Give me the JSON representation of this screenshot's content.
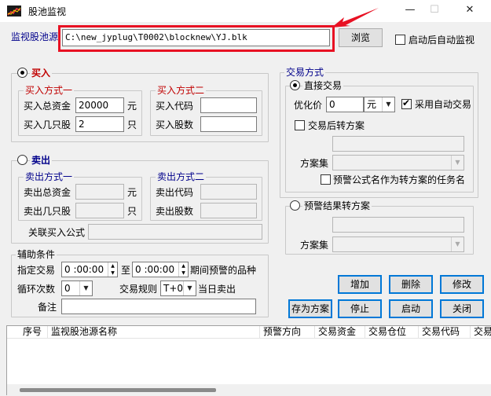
{
  "window": {
    "title": "股池监视",
    "min": "—",
    "max": "☐",
    "close": "✕"
  },
  "source": {
    "label": "监视股池源",
    "path": "C:\\new_jyplug\\T0002\\blocknew\\YJ.blk",
    "browse": "浏览",
    "autostart": "启动后自动监视",
    "autostart_checked": false
  },
  "buy": {
    "radio": "买入",
    "selected": true,
    "mode1": {
      "title": "买入方式一",
      "total_label": "买入总资金",
      "total_value": "20000",
      "total_unit": "元",
      "count_label": "买入几只股",
      "count_value": "2",
      "count_unit": "只"
    },
    "mode2": {
      "title": "买入方式二",
      "code_label": "买入代码",
      "qty_label": "买入股数"
    }
  },
  "sell": {
    "radio": "卖出",
    "selected": false,
    "mode1": {
      "title": "卖出方式一",
      "total_label": "卖出总资金",
      "total_unit": "元",
      "count_label": "卖出几只股",
      "count_unit": "只"
    },
    "mode2": {
      "title": "卖出方式二",
      "code_label": "卖出代码",
      "qty_label": "卖出股数"
    },
    "formula_label": "关联买入公式"
  },
  "trade": {
    "title": "交易方式",
    "direct": "直接交易",
    "direct_selected": true,
    "priority_label": "优化价",
    "priority_value": "0",
    "priority_unit": "元",
    "auto_trade": "采用自动交易",
    "auto_trade_checked": true,
    "after_trade": "交易后转方案",
    "after_trade_checked": false,
    "plan_set_label": "方案集",
    "use_formula": "预警公式名作为转方案的任务名",
    "use_formula_checked": false,
    "warn_result": "预警结果转方案",
    "warn_selected": false,
    "plan_set_label2": "方案集"
  },
  "aux": {
    "title": "辅助条件",
    "trade_time_label": "指定交易",
    "time_from": "0 :00:00",
    "to_label": "至",
    "time_to": "0 :00:00",
    "period_label": "期间预警的品种",
    "loop_label": "循环次数",
    "loop_value": "0",
    "rule_label": "交易规则",
    "rule_value": "T+0",
    "same_day": "当日卖出",
    "note_label": "备注"
  },
  "buttons": {
    "add": "增加",
    "delete": "删除",
    "modify": "修改",
    "save": "存为方案",
    "stop": "停止",
    "start": "启动",
    "close": "关闭"
  },
  "table": {
    "columns": [
      "序号",
      "监视股池源名称",
      "预警方向",
      "交易资金",
      "交易仓位",
      "交易代码",
      "交易"
    ]
  },
  "colors": {
    "group_title": "#00008b",
    "red_label": "#c00000",
    "highlight": "#e81123"
  }
}
